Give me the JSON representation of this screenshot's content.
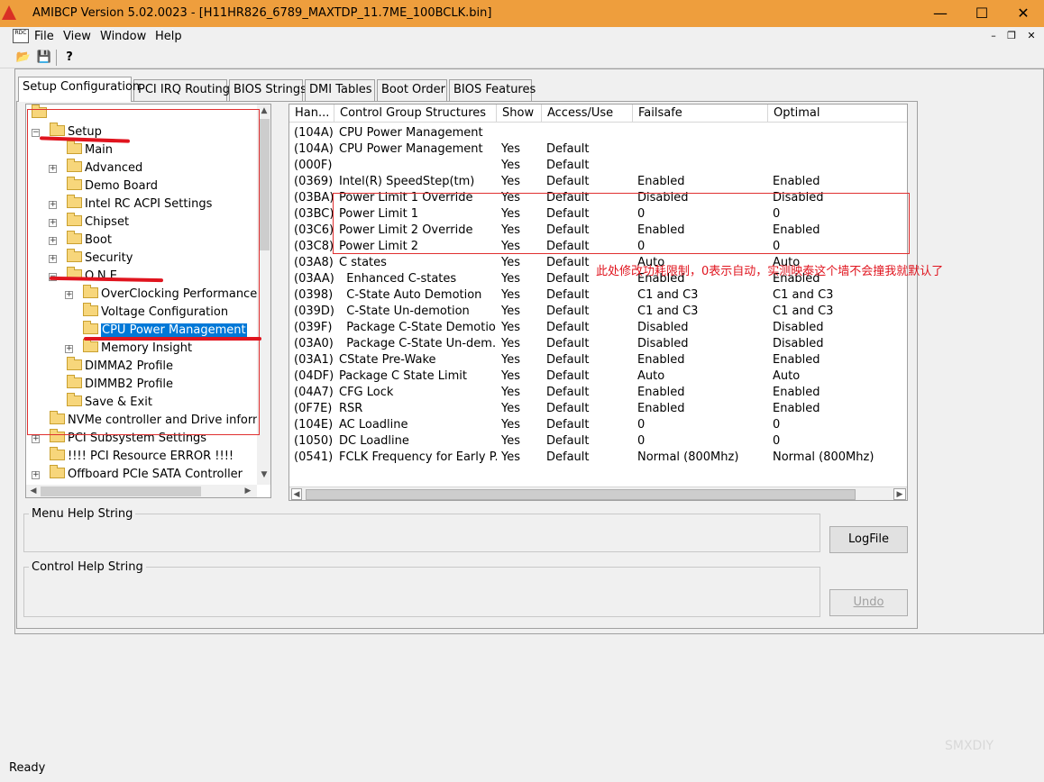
{
  "window": {
    "title": "AMIBCP Version 5.02.0023 - [H11HR826_6789_MAXTDP_11.7ME_100BCLK.bin]",
    "minimize": "—",
    "maximize": "☐",
    "close": "✕"
  },
  "menu": {
    "mdi_icon_label": "RDC",
    "items": [
      "File",
      "View",
      "Window",
      "Help"
    ],
    "mdi_minimize": "–",
    "mdi_restore": "❐",
    "mdi_close": "✕"
  },
  "toolbar": {
    "open": "📂",
    "save": "💾",
    "help": "?"
  },
  "tabs": [
    "Setup Configuration",
    "PCI IRQ Routing",
    "BIOS Strings",
    "DMI Tables",
    "Boot Order",
    "BIOS Features"
  ],
  "tree": {
    "expand_plus": "+",
    "expand_minus": "−",
    "nodes": [
      {
        "label": "",
        "exp": "minus"
      },
      {
        "label": "Setup",
        "exp": "minus"
      },
      {
        "label": "Main",
        "exp": ""
      },
      {
        "label": "Advanced",
        "exp": "plus"
      },
      {
        "label": "Demo Board",
        "exp": ""
      },
      {
        "label": "Intel RC ACPI Settings",
        "exp": "plus"
      },
      {
        "label": "Chipset",
        "exp": "plus"
      },
      {
        "label": "Boot",
        "exp": "plus"
      },
      {
        "label": "Security",
        "exp": "plus"
      },
      {
        "label": "O.N.E",
        "exp": "minus"
      },
      {
        "label": "OverClocking Performance",
        "exp": "plus"
      },
      {
        "label": "Voltage Configuration",
        "exp": ""
      },
      {
        "label": "CPU Power Management",
        "exp": "",
        "selected": true
      },
      {
        "label": "Memory Insight",
        "exp": "plus"
      },
      {
        "label": "DIMMA2 Profile",
        "exp": ""
      },
      {
        "label": "DIMMB2 Profile",
        "exp": ""
      },
      {
        "label": "Save & Exit",
        "exp": ""
      },
      {
        "label": "NVMe controller and Drive inform",
        "exp": ""
      },
      {
        "label": "PCI Subsystem Settings",
        "exp": "plus"
      },
      {
        "label": "!!!! PCI Resource ERROR !!!!",
        "exp": ""
      },
      {
        "label": "Offboard PCIe SATA Controller",
        "exp": "plus"
      }
    ]
  },
  "grid": {
    "headers": [
      "Han...",
      "Control Group Structures",
      "Show",
      "Access/Use",
      "Failsafe",
      "Optimal"
    ],
    "rows": [
      [
        "(104A)",
        "CPU Power Management",
        "",
        "",
        "",
        ""
      ],
      [
        "(104A)",
        "CPU Power Management",
        "Yes",
        "Default",
        "",
        ""
      ],
      [
        "(000F)",
        "",
        "Yes",
        "Default",
        "",
        ""
      ],
      [
        "(0369)",
        "Intel(R) SpeedStep(tm)",
        "Yes",
        "Default",
        "Enabled",
        "Enabled"
      ],
      [
        "(03BA)",
        "Power Limit 1 Override",
        "Yes",
        "Default",
        "Disabled",
        "Disabled"
      ],
      [
        "(03BC)",
        "Power Limit 1",
        "Yes",
        "Default",
        "0",
        "0"
      ],
      [
        "(03C6)",
        "Power Limit 2 Override",
        "Yes",
        "Default",
        "Enabled",
        "Enabled"
      ],
      [
        "(03C8)",
        "Power Limit 2",
        "Yes",
        "Default",
        "0",
        "0"
      ],
      [
        "(03A8)",
        "C states",
        "Yes",
        "Default",
        "Auto",
        "Auto"
      ],
      [
        "(03AA)",
        "  Enhanced C-states",
        "Yes",
        "Default",
        "Enabled",
        "Enabled"
      ],
      [
        "(0398)",
        "  C-State Auto Demotion",
        "Yes",
        "Default",
        "C1 and C3",
        "C1 and C3"
      ],
      [
        "(039D)",
        "  C-State Un-demotion",
        "Yes",
        "Default",
        "C1 and C3",
        "C1 and C3"
      ],
      [
        "(039F)",
        "  Package C-State Demotion",
        "Yes",
        "Default",
        "Disabled",
        "Disabled"
      ],
      [
        "(03A0)",
        "  Package C-State Un-dem...",
        "Yes",
        "Default",
        "Disabled",
        "Disabled"
      ],
      [
        "(03A1)",
        "CState Pre-Wake",
        "Yes",
        "Default",
        "Enabled",
        "Enabled"
      ],
      [
        "(04DF)",
        "Package C State Limit",
        "Yes",
        "Default",
        "Auto",
        "Auto"
      ],
      [
        "(04A7)",
        "CFG Lock",
        "Yes",
        "Default",
        "Enabled",
        "Enabled"
      ],
      [
        "(0F7E)",
        "RSR",
        "Yes",
        "Default",
        "Enabled",
        "Enabled"
      ],
      [
        "(104E)",
        "AC Loadline",
        "Yes",
        "Default",
        "0",
        "0"
      ],
      [
        "(1050)",
        "DC Loadline",
        "Yes",
        "Default",
        "0",
        "0"
      ],
      [
        "(0541)",
        "FCLK Frequency for Early P...",
        "Yes",
        "Default",
        "Normal (800Mhz)",
        "Normal (800Mhz)"
      ]
    ]
  },
  "help": {
    "menu_label": "Menu Help String",
    "control_label": "Control Help String",
    "logfile_button": "LogFile",
    "undo_button": "Undo"
  },
  "status": {
    "text": "Ready"
  },
  "annotation": {
    "text": "此处修改功耗限制，0表示自动，实测映泰这个墙不会撞我就默认了"
  },
  "watermark": {
    "text": "SMXDIY"
  },
  "colors": {
    "titlebar": "#ee9e3d",
    "annotation": "#e0141e",
    "selection": "#0078d7"
  }
}
